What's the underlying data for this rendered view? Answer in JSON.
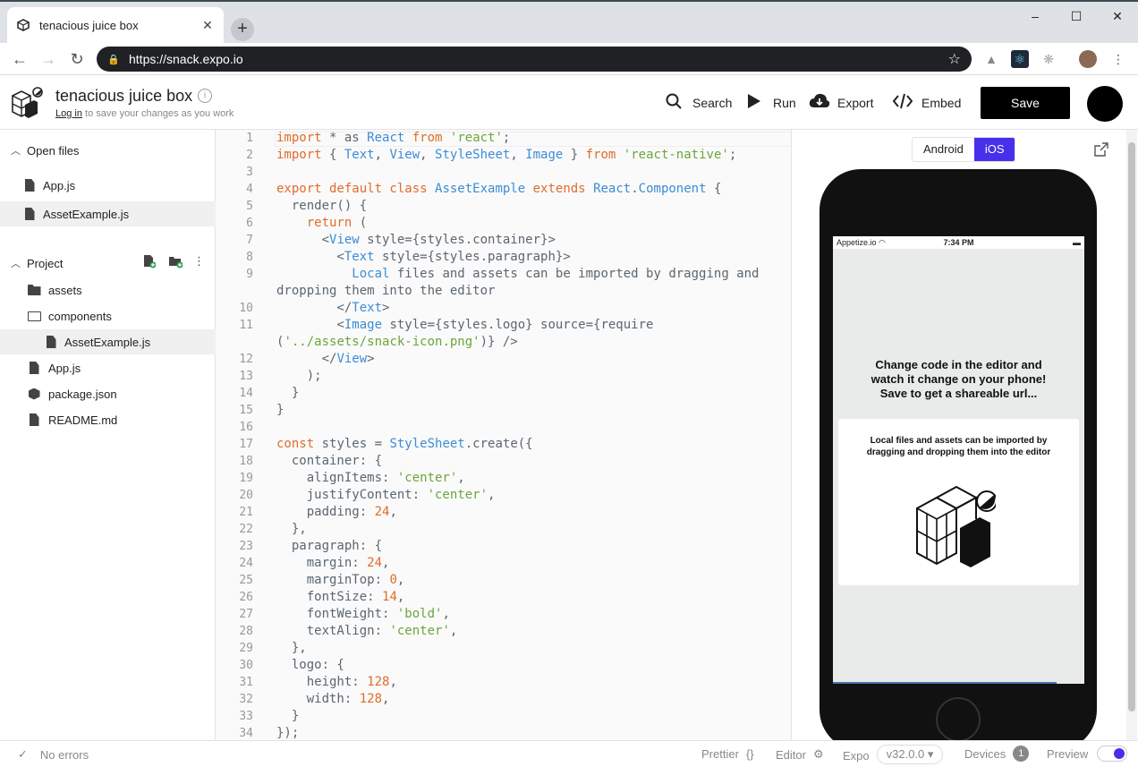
{
  "browser": {
    "tab_title": "tenacious juice box",
    "tab_close": "✕",
    "new_tab": "+",
    "url": "https://snack.expo.io",
    "window_controls": [
      "–",
      "☐",
      "✕"
    ]
  },
  "header": {
    "project_title": "tenacious juice box",
    "login_link": "Log in",
    "login_suffix": "to save your changes as you work",
    "search_label": "Search",
    "run_label": "Run",
    "export_label": "Export",
    "embed_label": "Embed",
    "save_label": "Save"
  },
  "sidebar": {
    "open_files_label": "Open files",
    "open_files": [
      "App.js",
      "AssetExample.js"
    ],
    "project_label": "Project",
    "project_tree": [
      {
        "name": "assets",
        "type": "folder"
      },
      {
        "name": "components",
        "type": "folder-open"
      },
      {
        "name": "AssetExample.js",
        "type": "file"
      },
      {
        "name": "App.js",
        "type": "file"
      },
      {
        "name": "package.json",
        "type": "package"
      },
      {
        "name": "README.md",
        "type": "file"
      }
    ]
  },
  "editor": {
    "line_numbers": [
      "1",
      "2",
      "3",
      "4",
      "5",
      "6",
      "7",
      "8",
      "9",
      "",
      "10",
      "11",
      "",
      "12",
      "13",
      "14",
      "15",
      "16",
      "17",
      "18",
      "19",
      "20",
      "21",
      "22",
      "23",
      "24",
      "25",
      "26",
      "27",
      "28",
      "29",
      "30",
      "31",
      "32",
      "33",
      "34"
    ]
  },
  "preview": {
    "android_label": "Android",
    "ios_label": "iOS",
    "carrier": "Appetize.io",
    "time": "7:34 PM",
    "heading": "Change code in the editor and watch it change on your phone! Save to get a shareable url...",
    "card_text": "Local files and assets can be imported by dragging and dropping them into the editor"
  },
  "footer": {
    "errors_label": "No errors",
    "prettier_label": "Prettier",
    "prettier_icon": "{}",
    "editor_label": "Editor",
    "expo_label": "Expo",
    "expo_version": "v32.0.0 ▾",
    "devices_label": "Devices",
    "devices_count": "1",
    "preview_label": "Preview"
  },
  "colors": {
    "accent": "#4630eb",
    "keyword": "#e06c2b",
    "identifier": "#3c8cd6",
    "string": "#6ba53a"
  }
}
